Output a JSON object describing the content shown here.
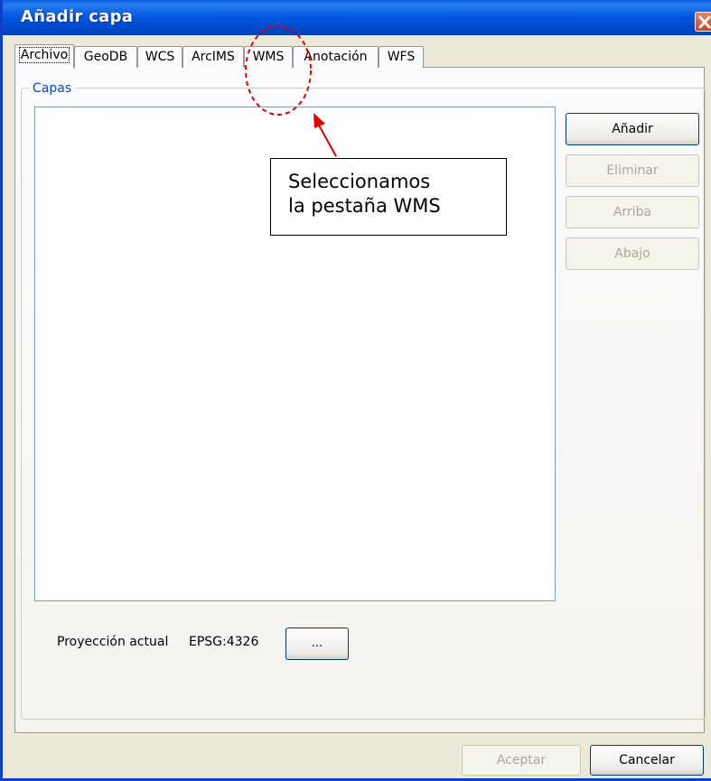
{
  "window": {
    "title": "Añadir capa"
  },
  "tabs": [
    "Archivo",
    "GeoDB",
    "WCS",
    "ArcIMS",
    "WMS",
    "Anotación",
    "WFS"
  ],
  "group": {
    "label": "Capas"
  },
  "side_buttons": {
    "add": "Añadir",
    "remove": "Eliminar",
    "up": "Arriba",
    "down": "Abajo"
  },
  "projection": {
    "label": "Proyección actual",
    "value": "EPSG:4326",
    "button": "..."
  },
  "footer": {
    "accept": "Aceptar",
    "cancel": "Cancelar"
  },
  "annotation": {
    "line1": "Seleccionamos",
    "line2": "la pestaña WMS"
  }
}
